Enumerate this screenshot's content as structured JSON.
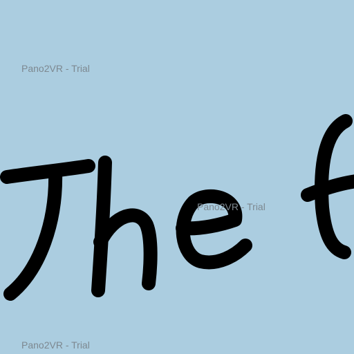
{
  "panorama": {
    "background_color": "#abcde0",
    "text_color": "#000000",
    "visible_text": "The f"
  },
  "watermarks": [
    {
      "text": "Pano2VR - Trial"
    },
    {
      "text": "Pano2VR - Trial"
    },
    {
      "text": "Pano2VR - Trial"
    }
  ]
}
